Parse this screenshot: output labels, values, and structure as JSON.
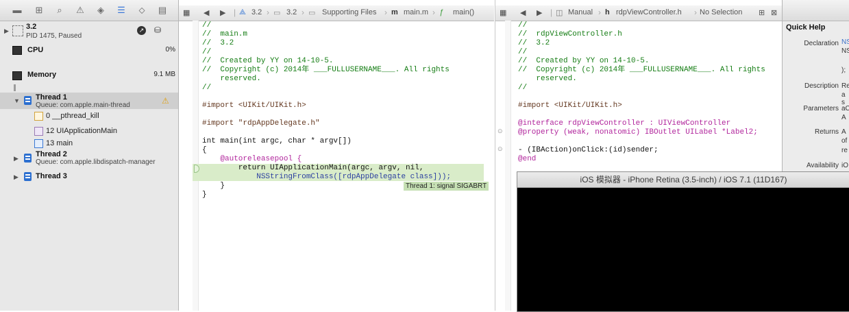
{
  "navigator": {
    "process": {
      "name": "3.2",
      "status": "PID 1475, Paused"
    },
    "gauges": [
      {
        "name": "CPU",
        "value": "0%"
      },
      {
        "name": "Memory",
        "value": "9.1 MB"
      }
    ],
    "threads": [
      {
        "title": "Thread 1",
        "queue": "Queue: com.apple.main-thread",
        "frames": [
          {
            "label": "0 __pthread_kill",
            "kind": "c"
          },
          {
            "label": "12 UIApplicationMain",
            "kind": "uikit"
          },
          {
            "label": "13 main",
            "kind": "user"
          }
        ]
      },
      {
        "title": "Thread 2",
        "queue": "Queue: com.apple.libdispatch-manager"
      },
      {
        "title": "Thread 3"
      }
    ]
  },
  "left_editor": {
    "breadcrumbs": [
      "3.2",
      "3.2",
      "Supporting Files",
      "main.m",
      "main()"
    ],
    "lines": [
      "//",
      "//  main.m",
      "//  3.2",
      "//",
      "//  Created by YY on 14-10-5.",
      "//  Copyright (c) 2014年 ___FULLUSERNAME___. All rights",
      "    reserved.",
      "//",
      "",
      "#import <UIKit/UIKit.h>",
      "",
      "#import \"rdpAppDelegate.h\"",
      "",
      "int main(int argc, char * argv[])",
      "{",
      "    @autoreleasepool {",
      "        return UIApplicationMain(argc, argv, nil,",
      "            NSStringFromClass([rdpAppDelegate class]));",
      "    }",
      "}"
    ],
    "error_badge": "Thread 1: signal SIGABRT"
  },
  "right_editor": {
    "mode": "Manual",
    "file": "rdpViewController.h",
    "selection": "No Selection",
    "lines": [
      "//",
      "//  rdpViewController.h",
      "//  3.2",
      "//",
      "//  Created by YY on 14-10-5.",
      "//  Copyright (c) 2014年 ___FULLUSERNAME___. All rights",
      "    reserved.",
      "//",
      "",
      "#import <UIKit/UIKit.h>",
      "",
      "@interface rdpViewController : UIViewController",
      "@property (weak, nonatomic) IBOutlet UILabel *Label2;",
      "",
      "- (IBAction)onClick:(id)sender;",
      "@end"
    ]
  },
  "inspector": {
    "title": "Quick Help",
    "fields": [
      {
        "label": "Declaration",
        "value": "NS",
        "value2": "NS",
        "value3": ");"
      },
      {
        "label": "Description",
        "value": "Re",
        "value2": "a s"
      },
      {
        "label": "Parameters",
        "value": "aC",
        "value2": "A"
      },
      {
        "label": "Returns",
        "value": "A",
        "value2": "of",
        "value3": "re"
      },
      {
        "label": "Availability",
        "value": "iO"
      }
    ]
  },
  "simulator": {
    "title": "iOS 模拟器 - iPhone Retina (3.5-inch) / iOS 7.1 (11D167)"
  },
  "colors": {
    "comment": "#157d14",
    "keyword": "#b1259c",
    "string": "#c41a16",
    "highlight": "#d9ecc9"
  }
}
